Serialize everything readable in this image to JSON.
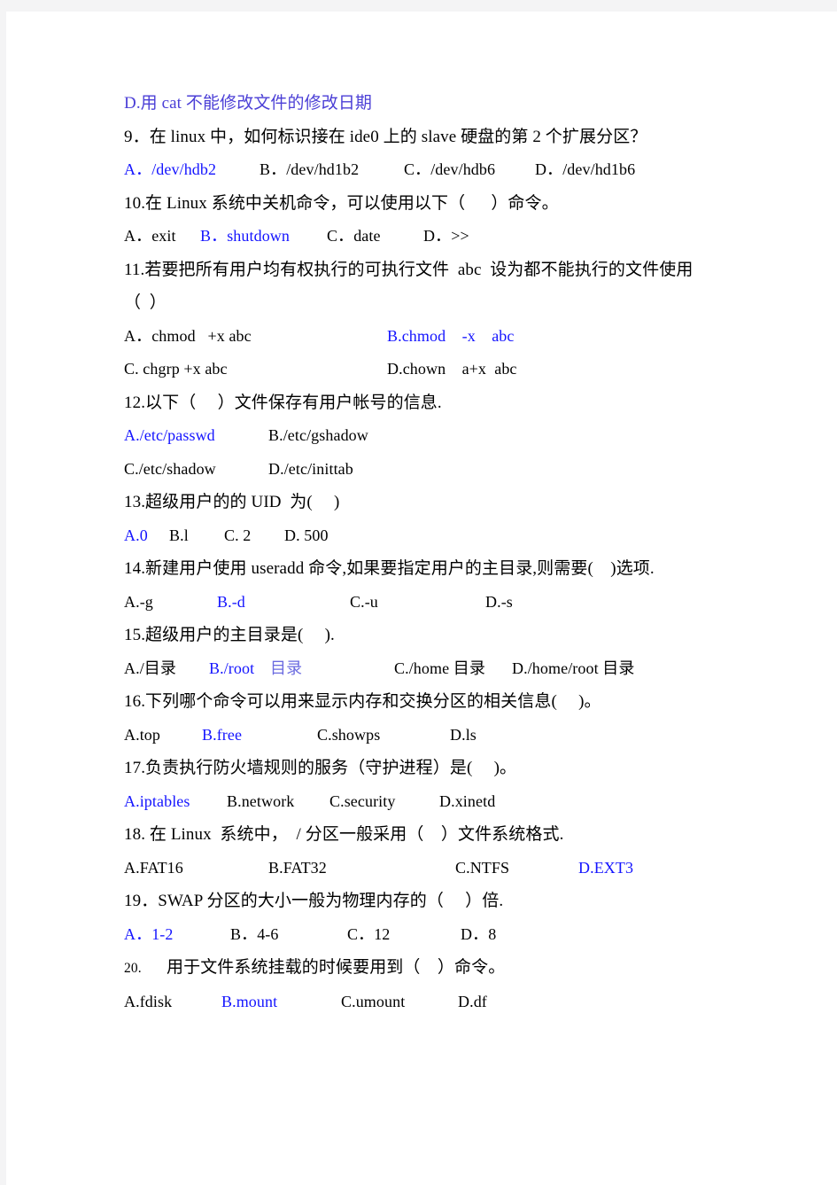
{
  "document": {
    "type": "exam-paper",
    "language": "zh-CN",
    "subject": "Linux"
  },
  "lines": [
    {
      "id": "q8_d",
      "text": "D.用 cat 不能修改文件的修改日期"
    },
    {
      "id": "q9",
      "text": "9．在 linux 中，如何标识接在 ide0 上的 slave 硬盘的第 2 个扩展分区？"
    },
    {
      "id": "q9_a",
      "text": "A．/dev/hdb2"
    },
    {
      "id": "q9_b",
      "text": "B．/dev/hd1b2"
    },
    {
      "id": "q9_c",
      "text": "C．/dev/hdb6"
    },
    {
      "id": "q9_d",
      "text": "D．/dev/hd1b6"
    },
    {
      "id": "q10",
      "text": "10.在 Linux 系统中关机命令，可以使用以下（      ）命令。"
    },
    {
      "id": "q10_a",
      "text": "A．exit"
    },
    {
      "id": "q10_b",
      "text": "B．shutdown"
    },
    {
      "id": "q10_c",
      "text": "C．date"
    },
    {
      "id": "q10_d",
      "text": "D．>>"
    },
    {
      "id": "q11_1",
      "text": "11.若要把所有用户均有权执行的可执行文件  abc  设为都不能执行的文件使用"
    },
    {
      "id": "q11_2",
      "text": "（  ）"
    },
    {
      "id": "q11_a",
      "text": "A．chmod   +x abc"
    },
    {
      "id": "q11_b",
      "text": "B.chmod    -x    abc"
    },
    {
      "id": "q11_c",
      "text": "C. chgrp +x abc"
    },
    {
      "id": "q11_d",
      "text": "D.chown    a+x  abc"
    },
    {
      "id": "q12",
      "text": "12.以下（     ）文件保存有用户帐号的信息."
    },
    {
      "id": "q12_a",
      "text": "A./etc/passwd"
    },
    {
      "id": "q12_b",
      "text": "B./etc/gshadow"
    },
    {
      "id": "q12_c",
      "text": "C./etc/shadow"
    },
    {
      "id": "q12_d",
      "text": "D./etc/inittab"
    },
    {
      "id": "q13",
      "text": "13.超级用户的的 UID  为(     )"
    },
    {
      "id": "q13_a",
      "text": "A.0"
    },
    {
      "id": "q13_b",
      "text": "B.l"
    },
    {
      "id": "q13_c",
      "text": "C. 2"
    },
    {
      "id": "q13_d",
      "text": "D. 500"
    },
    {
      "id": "q14",
      "text": "14.新建用户使用 useradd 命令,如果要指定用户的主目录,则需要(    )选项."
    },
    {
      "id": "q14_a",
      "text": "A.-g"
    },
    {
      "id": "q14_b",
      "text": "B.-d"
    },
    {
      "id": "q14_c",
      "text": "C.-u"
    },
    {
      "id": "q14_d",
      "text": "D.-s"
    },
    {
      "id": "q15",
      "text": "15.超级用户的主目录是(     )."
    },
    {
      "id": "q15_a",
      "text": "A./目录"
    },
    {
      "id": "q15_b1",
      "text": "B./root"
    },
    {
      "id": "q15_b2",
      "text": "目录"
    },
    {
      "id": "q15_c",
      "text": "C./home 目录"
    },
    {
      "id": "q15_d",
      "text": "D./home/root 目录"
    },
    {
      "id": "q16",
      "text": "16.下列哪个命令可以用来显示内存和交换分区的相关信息(     )。"
    },
    {
      "id": "q16_a",
      "text": "A.top"
    },
    {
      "id": "q16_b",
      "text": "B.free"
    },
    {
      "id": "q16_c",
      "text": "C.showps"
    },
    {
      "id": "q16_d",
      "text": "D.ls"
    },
    {
      "id": "q17",
      "text": "17.负责执行防火墙规则的服务（守护进程）是(     )。"
    },
    {
      "id": "q17_a",
      "text": "A.iptables"
    },
    {
      "id": "q17_b",
      "text": "B.network"
    },
    {
      "id": "q17_c",
      "text": "C.security"
    },
    {
      "id": "q17_d",
      "text": "D.xinetd"
    },
    {
      "id": "q18",
      "text": "18. 在 Linux  系统中，  / 分区一般采用（    ）文件系统格式."
    },
    {
      "id": "q18_a",
      "text": "A.FAT16"
    },
    {
      "id": "q18_b",
      "text": "B.FAT32"
    },
    {
      "id": "q18_c",
      "text": "C.NTFS"
    },
    {
      "id": "q18_d",
      "text": "D.EXT3"
    },
    {
      "id": "q19",
      "text": "19．SWAP 分区的大小一般为物理内存的（     ）倍."
    },
    {
      "id": "q19_a",
      "text": "A．1-2"
    },
    {
      "id": "q19_b",
      "text": "B．4-6"
    },
    {
      "id": "q19_c",
      "text": "C．12"
    },
    {
      "id": "q19_d",
      "text": "D．8"
    },
    {
      "id": "q20_num",
      "text": "20."
    },
    {
      "id": "q20",
      "text": "用于文件系统挂载的时候要用到（    ）命令。"
    },
    {
      "id": "q20_a",
      "text": "A.fdisk"
    },
    {
      "id": "q20_b",
      "text": "B.mount"
    },
    {
      "id": "q20_c",
      "text": "C.umount"
    },
    {
      "id": "q20_d",
      "text": "D.df"
    }
  ],
  "colors": {
    "answer_blue": "#1414ff",
    "answer_violet": "#4b3fd6",
    "answer_lilac": "#6a6ae0",
    "body_ink": "#111111",
    "page_white": "#ffffff",
    "backdrop_grey": "#f4f4f5"
  }
}
